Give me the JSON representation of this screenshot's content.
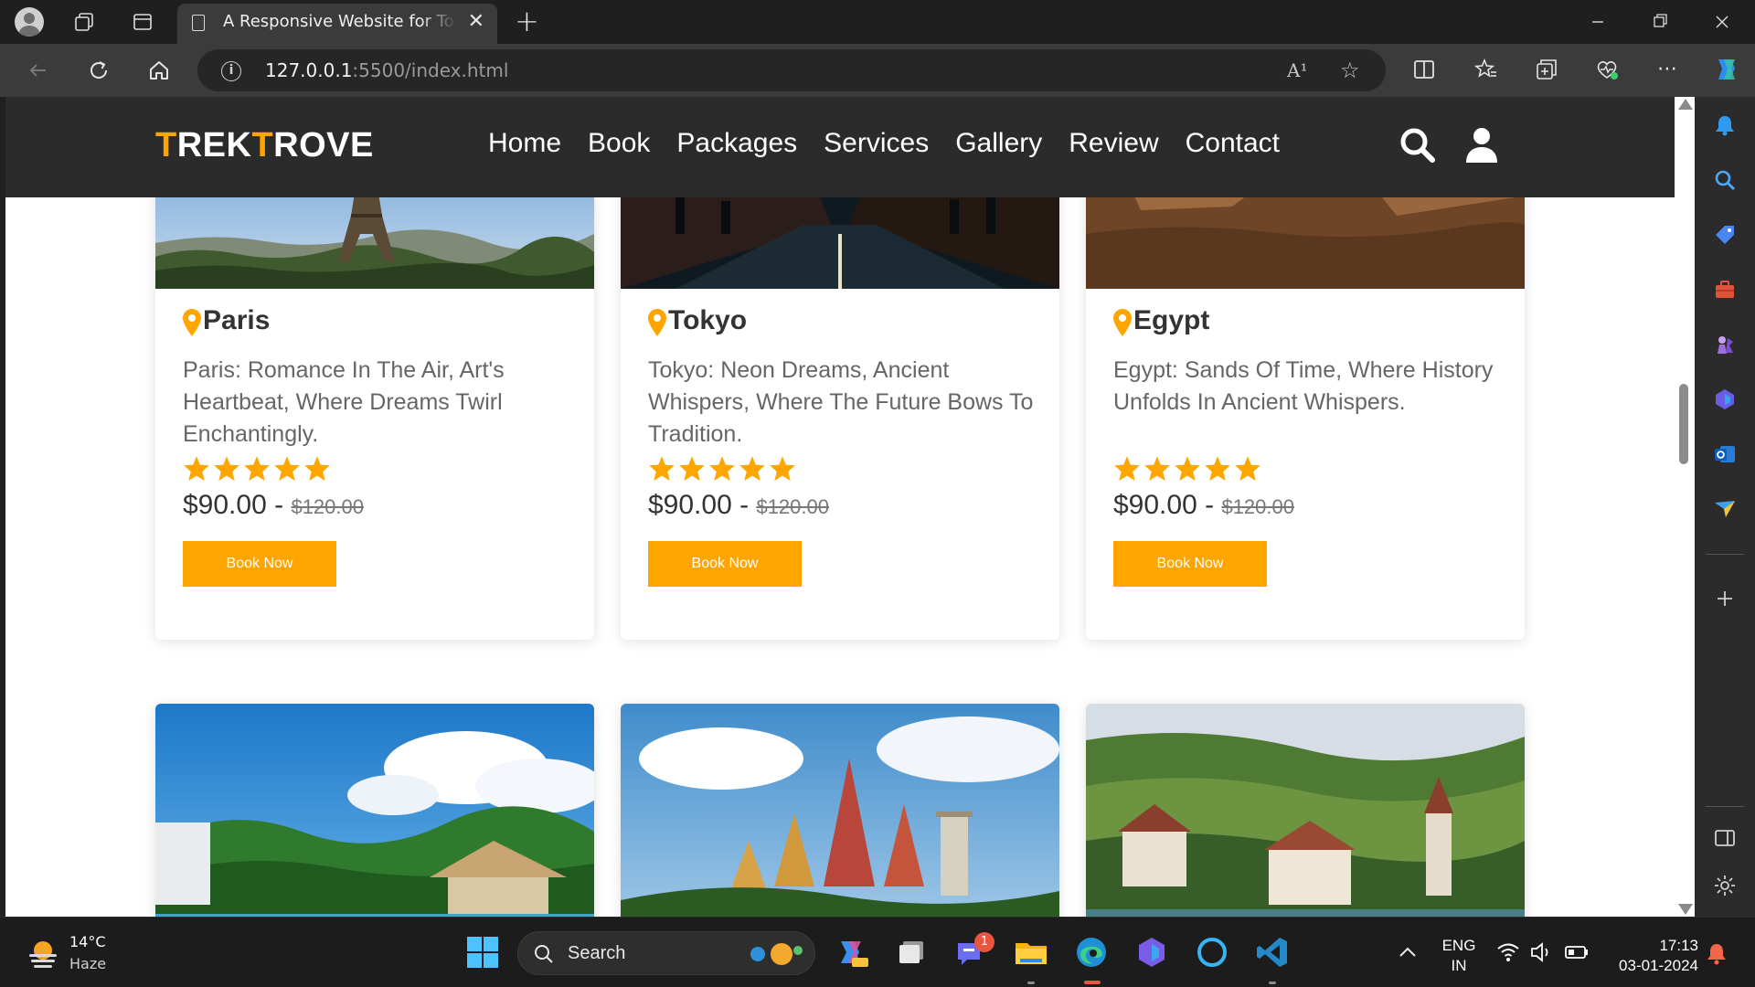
{
  "browser": {
    "tab_title": "A Responsive Website for Tour Agency",
    "url_host": "127.0.0.1",
    "url_path": ":5500/index.html",
    "read_aloud": "A¹"
  },
  "site": {
    "logo": {
      "a": "T",
      "b": "REK",
      "c": "T",
      "d": "ROVE"
    },
    "nav": [
      "Home",
      "Book",
      "Packages",
      "Services",
      "Gallery",
      "Review",
      "Contact"
    ],
    "accent_color": "#ffa500",
    "cards": [
      {
        "title": "Paris",
        "description": "Paris: Romance In The Air, Art's Heartbeat, Where Dreams Twirl Enchantingly.",
        "rating": 5,
        "price": "$90.00",
        "separator": "-",
        "old_price": "$120.00",
        "button": "Book Now"
      },
      {
        "title": "Tokyo",
        "description": "Tokyo: Neon Dreams, Ancient Whispers, Where The Future Bows To Tradition.",
        "rating": 5,
        "price": "$90.00",
        "separator": "-",
        "old_price": "$120.00",
        "button": "Book Now"
      },
      {
        "title": "Egypt",
        "description": "Egypt: Sands Of Time, Where History Unfolds In Ancient Whispers.",
        "rating": 5,
        "price": "$90.00",
        "separator": "-",
        "old_price": "$120.00",
        "button": "Book Now"
      }
    ],
    "next_row_images": [
      "maldives-beach-photo",
      "thai-temple-photo",
      "swiss-town-photo"
    ]
  },
  "taskbar": {
    "weather_temp": "14°C",
    "weather_desc": "Haze",
    "search_label": "Search",
    "teams_badge": "1",
    "lang_1": "ENG",
    "lang_2": "IN",
    "time": "17:13",
    "date": "03-01-2024"
  }
}
